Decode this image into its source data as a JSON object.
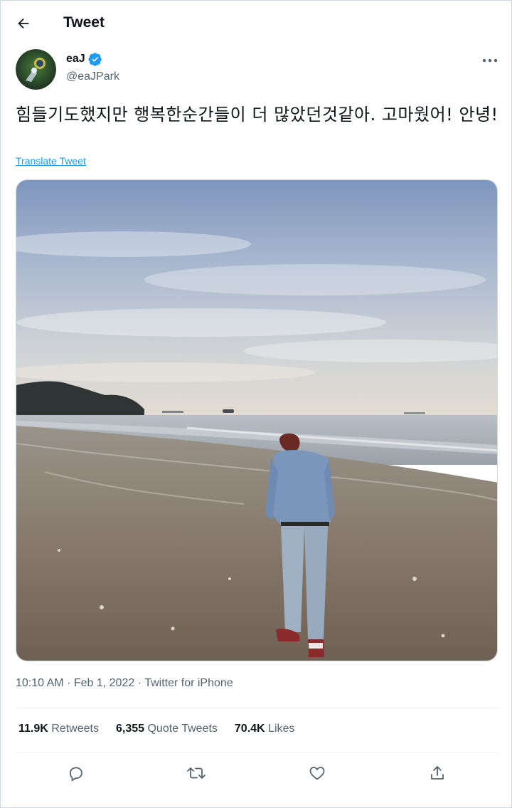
{
  "header": {
    "back_icon": "arrow-left-icon",
    "title": "Tweet"
  },
  "author": {
    "name": "eaJ",
    "handle": "@eaJPark",
    "verified_icon": "verified-badge-icon",
    "verified_color": "#1d9bf0",
    "more_icon": "more-horizontal-icon"
  },
  "tweet": {
    "text": "힘들기도했지만 행복한순간들이 더 많았던것같아. 고마웠어! 안녕!",
    "translate_label": "Translate Tweet"
  },
  "meta": {
    "time": "10:10 AM",
    "separator": "·",
    "date": "Feb 1, 2022",
    "source": "Twitter for iPhone"
  },
  "stats": {
    "retweets_count": "11.9K",
    "retweets_label": "Retweets",
    "quotes_count": "6,355",
    "quotes_label": "Quote Tweets",
    "likes_count": "70.4K",
    "likes_label": "Likes"
  },
  "actions": {
    "reply_icon": "reply-icon",
    "retweet_icon": "retweet-icon",
    "like_icon": "heart-icon",
    "share_icon": "share-icon"
  },
  "colors": {
    "accent": "#1d9bf0",
    "text_primary": "#0f1419",
    "text_secondary": "#536471",
    "border": "#cfd9de"
  }
}
